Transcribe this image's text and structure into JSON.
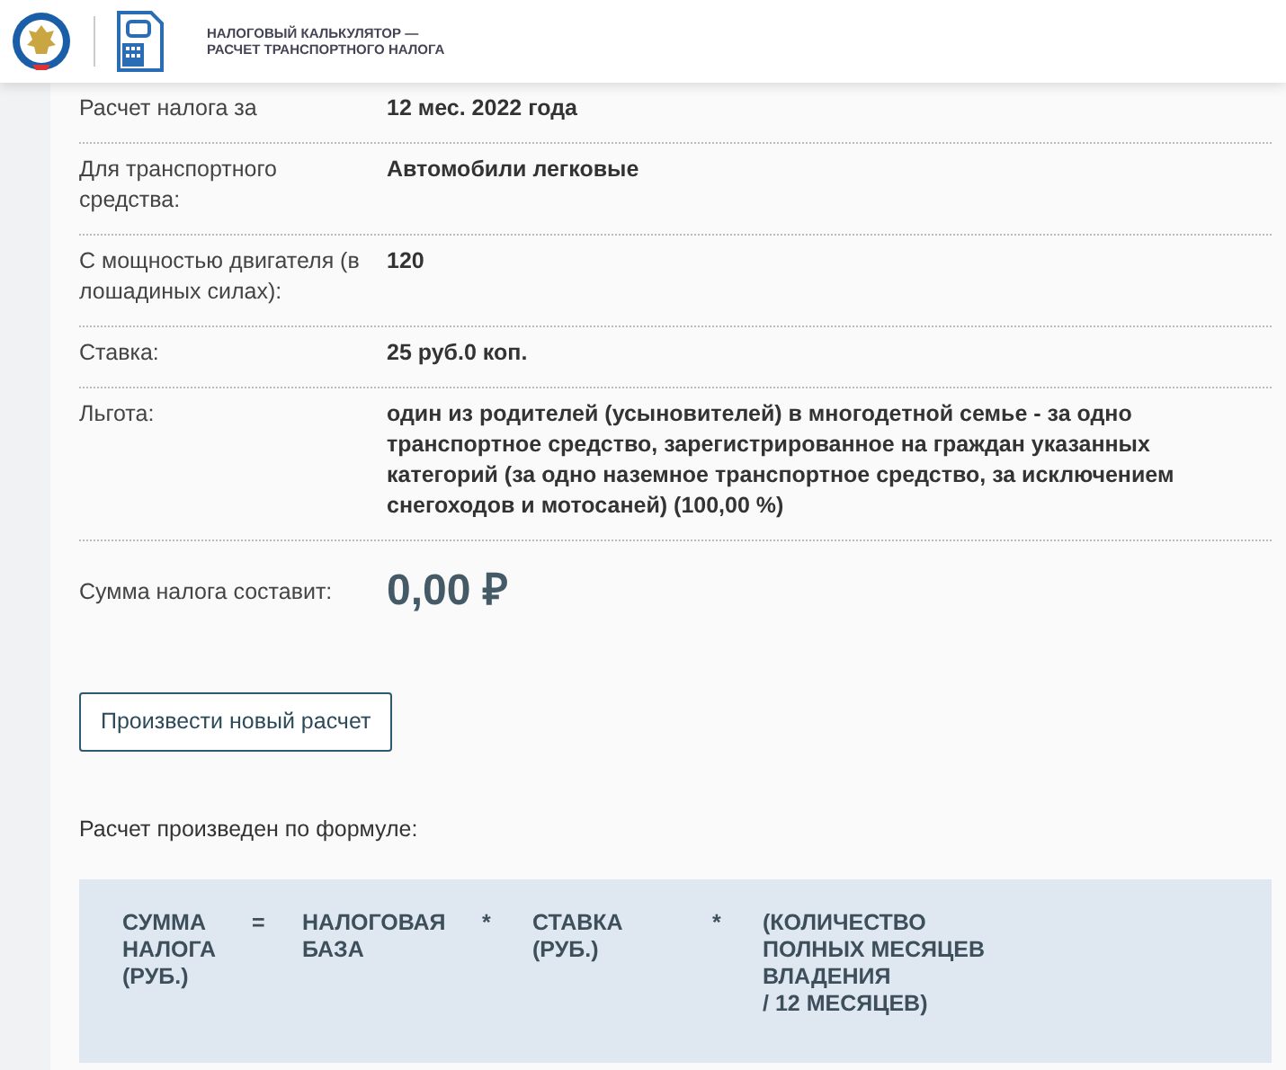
{
  "header": {
    "title_lines": [
      "НАЛОГОВЫЙ КАЛЬКУЛЯТОР —",
      "РАСЧЕТ ТРАНСПОРТНОГО НАЛОГА"
    ]
  },
  "details": [
    {
      "label": "Расчет налога за",
      "value": "12 мес. 2022 года"
    },
    {
      "label": "Для транспортного средства:",
      "value": "Автомобили легковые"
    },
    {
      "label": "С мощностью двигателя (в лошадиных силах):",
      "value": "120"
    },
    {
      "label": "Ставка:",
      "value": "25 руб.0 коп."
    },
    {
      "label": "Льгота:",
      "value": "один из родителей (усыновителей) в многодетной семье - за одно транспортное средство, зарегистрированное на граждан указанных категорий (за одно наземное транспортное средство, за исключением снегоходов и мотосаней) (100,00 %)"
    }
  ],
  "total": {
    "label": "Сумма налога составит:",
    "value": "0,00 ₽"
  },
  "new_calc_button": "Произвести новый расчет",
  "formula_caption": "Расчет произведен по формуле:",
  "formula": [
    {
      "kind": "term",
      "text": "СУММА\nНАЛОГА\n(РУБ.)"
    },
    {
      "kind": "operator",
      "text": "="
    },
    {
      "kind": "term",
      "text": "НАЛОГОВАЯ\nБАЗА"
    },
    {
      "kind": "operator",
      "text": "*"
    },
    {
      "kind": "term",
      "text": "СТАВКА\n(РУБ.)"
    },
    {
      "kind": "operator",
      "text": "*"
    },
    {
      "kind": "term",
      "text": "(КОЛИЧЕСТВО\nПОЛНЫХ МЕСЯЦЕВ\nВЛАДЕНИЯ\n/ 12 МЕСЯЦЕВ)"
    }
  ]
}
